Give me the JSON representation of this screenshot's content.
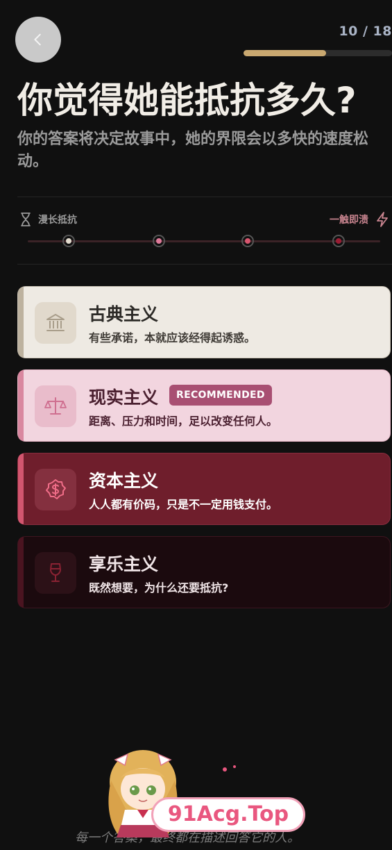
{
  "header": {
    "progress_text": "10 / 18",
    "progress_fraction": 0.556
  },
  "question": {
    "title": "你觉得她能抵抗多久?",
    "subtitle": "你的答案将决定故事中，她的界限会以多快的速度松动。"
  },
  "scale": {
    "left_label": "漫长抵抗",
    "right_label": "一触即溃",
    "left_icon": "hourglass-icon",
    "right_icon": "lightning-icon",
    "dot_colors": [
      "#e3dccf",
      "#de7a9a",
      "#d8566f",
      "#9b1d34"
    ]
  },
  "options": [
    {
      "title": "古典主义",
      "desc": "有些承诺，本就应该经得起诱惑。",
      "icon": "classical-building-icon"
    },
    {
      "title": "现实主义",
      "desc": "距离、压力和时间，足以改变任何人。",
      "icon": "balance-scale-icon",
      "badge": "RECOMMENDED"
    },
    {
      "title": "资本主义",
      "desc": "人人都有价码，只是不一定用钱支付。",
      "icon": "dollar-badge-icon"
    },
    {
      "title": "享乐主义",
      "desc": "既然想要，为什么还要抵抗?",
      "icon": "wine-glass-icon"
    }
  ],
  "footer": {
    "quote": "每一个答案，最终都在描述回答它的人。"
  },
  "watermark": {
    "text": "91Acg.Top"
  }
}
